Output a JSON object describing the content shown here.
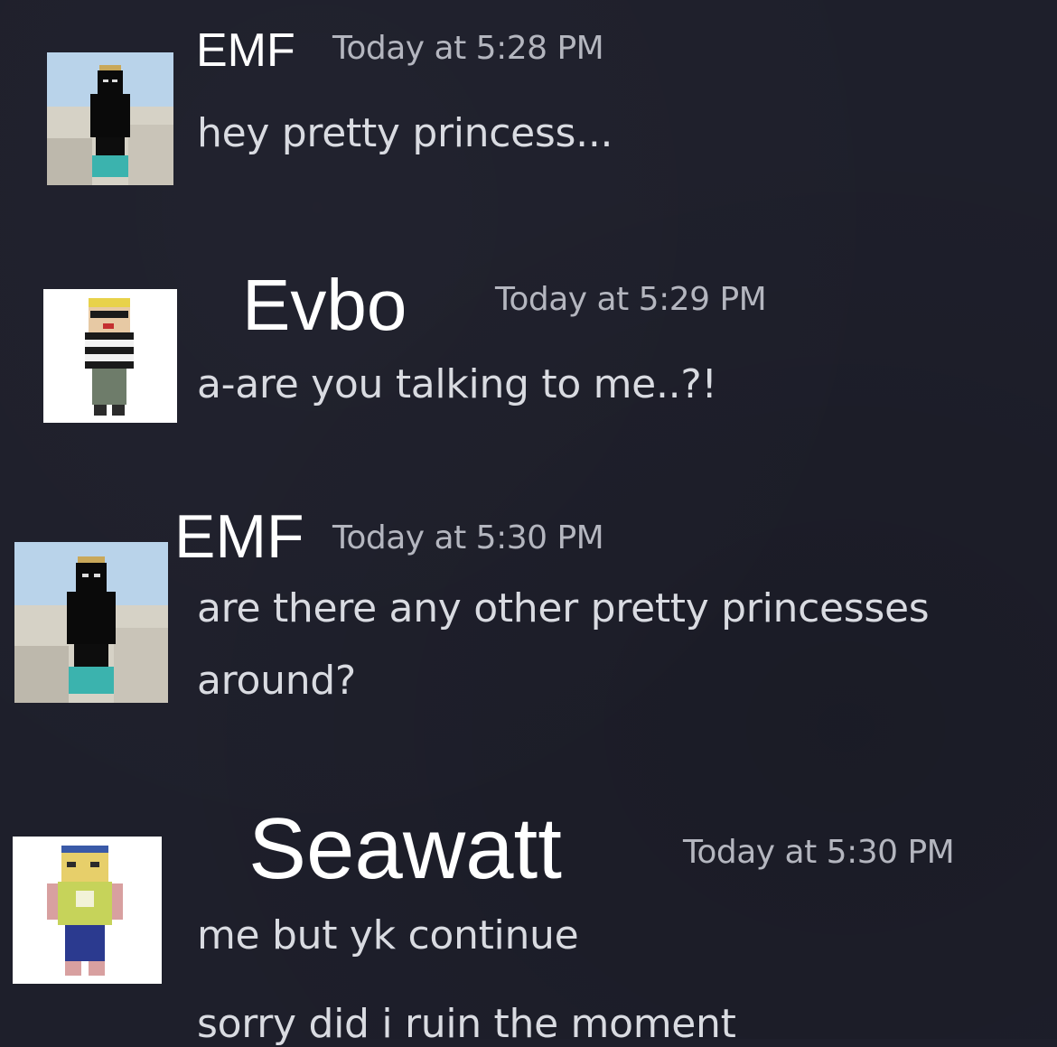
{
  "messages": [
    {
      "username": "EMF",
      "timestamp": "Today at 5:28 PM",
      "avatar_icon": "minecraft-skin-black-crown-avatar",
      "lines": [
        "hey pretty princess..."
      ]
    },
    {
      "username": "Evbo",
      "timestamp": "Today at 5:29 PM",
      "avatar_icon": "minecraft-skin-striped-sunglasses-avatar",
      "lines": [
        "a-are you talking to me..?!"
      ]
    },
    {
      "username": "EMF",
      "timestamp": "Today at 5:30 PM",
      "avatar_icon": "minecraft-skin-black-crown-avatar",
      "lines": [
        "are there any other pretty princesses",
        "around?"
      ]
    },
    {
      "username": "Seawatt",
      "timestamp": "Today at 5:30 PM",
      "avatar_icon": "minecraft-skin-yellow-green-avatar",
      "lines": [
        "me but yk continue",
        "sorry did i ruin the moment"
      ]
    }
  ],
  "colors": {
    "background": "#1e1f2b",
    "username": "#ffffff",
    "timestamp": "#b4b6bf",
    "message": "#d9dbe1"
  }
}
